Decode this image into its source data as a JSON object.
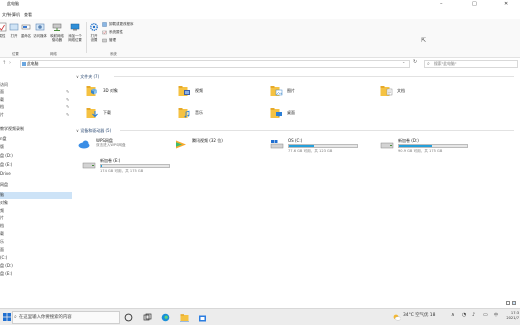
{
  "window": {
    "title": "此电脑",
    "minimize": "–",
    "maximize": "□",
    "close": "✕"
  },
  "menubar": {
    "file": "文件",
    "computer": "计算机",
    "view": "查看"
  },
  "ribbon": {
    "properties": "属性",
    "open": "打开",
    "rename": "重命名",
    "access_media": "访问媒体",
    "map_drive": "映射网络\n驱动器",
    "add_location": "添加一个\n网络位置",
    "open_settings": "打开\n设置",
    "uninstall": "卸载或更改程序",
    "system_props": "系统属性",
    "manage": "管理",
    "group_location": "位置",
    "group_network": "网络",
    "group_system": "系统"
  },
  "address": {
    "path": "此电脑",
    "search_placeholder": "搜索\"此电脑\""
  },
  "nav": {
    "items": [
      {
        "label": "访问",
        "sel": false,
        "pin": false
      },
      {
        "label": "面",
        "sel": false,
        "pin": true
      },
      {
        "label": "载",
        "sel": false,
        "pin": true
      },
      {
        "label": "档",
        "sel": false,
        "pin": true
      },
      {
        "label": "片",
        "sel": false,
        "pin": true
      },
      {
        "label": "教学视频录制",
        "sel": false,
        "pin": false
      },
      {
        "label": "n盘",
        "sel": false,
        "pin": false
      },
      {
        "label": "版",
        "sel": false,
        "pin": false
      },
      {
        "label": "盘 (D:)",
        "sel": false,
        "pin": false
      },
      {
        "label": "盘 (E:)",
        "sel": false,
        "pin": false
      },
      {
        "label": "Drive",
        "sel": false,
        "pin": false
      },
      {
        "label": "网盘",
        "sel": false,
        "pin": false
      },
      {
        "label": "脑",
        "sel": true,
        "pin": false
      },
      {
        "label": "对象",
        "sel": false,
        "pin": false
      },
      {
        "label": "频",
        "sel": false,
        "pin": false
      },
      {
        "label": "片",
        "sel": false,
        "pin": false
      },
      {
        "label": "档",
        "sel": false,
        "pin": false
      },
      {
        "label": "载",
        "sel": false,
        "pin": false
      },
      {
        "label": "乐",
        "sel": false,
        "pin": false
      },
      {
        "label": "面",
        "sel": false,
        "pin": false
      },
      {
        "label": "(C:)",
        "sel": false,
        "pin": false
      },
      {
        "label": "盘 (D:)",
        "sel": false,
        "pin": false
      },
      {
        "label": "盘 (E:)",
        "sel": false,
        "pin": false
      }
    ]
  },
  "sections": {
    "folders": "文件夹 (7)",
    "devices": "设备和驱动器 (5)"
  },
  "folders": [
    {
      "label": "3D 对象",
      "kind": "3d"
    },
    {
      "label": "视频",
      "kind": "video"
    },
    {
      "label": "图片",
      "kind": "pictures"
    },
    {
      "label": "文档",
      "kind": "docs"
    },
    {
      "label": "下载",
      "kind": "download"
    },
    {
      "label": "音乐",
      "kind": "music"
    },
    {
      "label": "桌面",
      "kind": "desktop"
    }
  ],
  "drives": [
    {
      "name": "WPS网盘",
      "sub": "双击进入WPS网盘",
      "kind": "cloud",
      "fill": null
    },
    {
      "name": "腾讯视频 (32 位)",
      "sub": "",
      "kind": "tencent",
      "fill": null
    },
    {
      "name": "OS (C:)",
      "sub": "77.6 GB 可用，共 123 GB",
      "kind": "os",
      "fill": 0.37
    },
    {
      "name": "新加卷 (D:)",
      "sub": "90.9 GB 可用，共 175 GB",
      "kind": "hdd",
      "fill": 0.48
    },
    {
      "name": "新加卷 (E:)",
      "sub": "174 GB 可用，共 175 GB",
      "kind": "hdd",
      "fill": 0.01
    }
  ],
  "taskbar": {
    "search": "在这里输入你要搜索的内容",
    "weather": "34°C 空气优 18",
    "time": "17:3",
    "date": "2021/7"
  },
  "colors": {
    "accent": "#26a0da",
    "folder": "#f5c242",
    "selected": "#cde3f7"
  }
}
